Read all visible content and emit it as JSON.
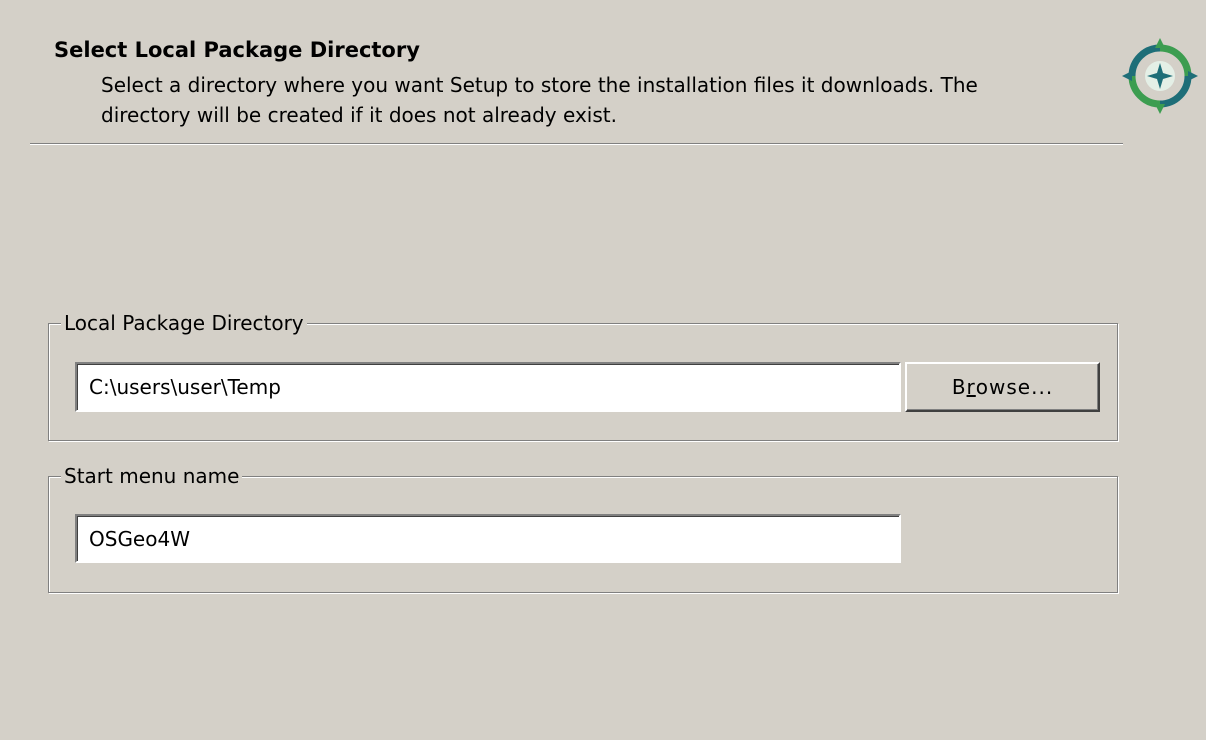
{
  "header": {
    "title": "Select Local Package Directory",
    "description": "Select a directory where you want Setup to store the installation files it downloads.  The directory will be created if it does not already exist."
  },
  "logo": {
    "icon": "osgeo-compass-logo",
    "colors": {
      "green": "#3c9d50",
      "teal": "#1e6e78"
    }
  },
  "local_package": {
    "legend": "Local Package Directory",
    "path_value": "C:\\users\\user\\Temp",
    "browse_button": {
      "prefix": "B",
      "mnemonic": "r",
      "suffix": "owse..."
    }
  },
  "start_menu": {
    "legend": "Start menu name",
    "name_value": "OSGeo4W"
  }
}
